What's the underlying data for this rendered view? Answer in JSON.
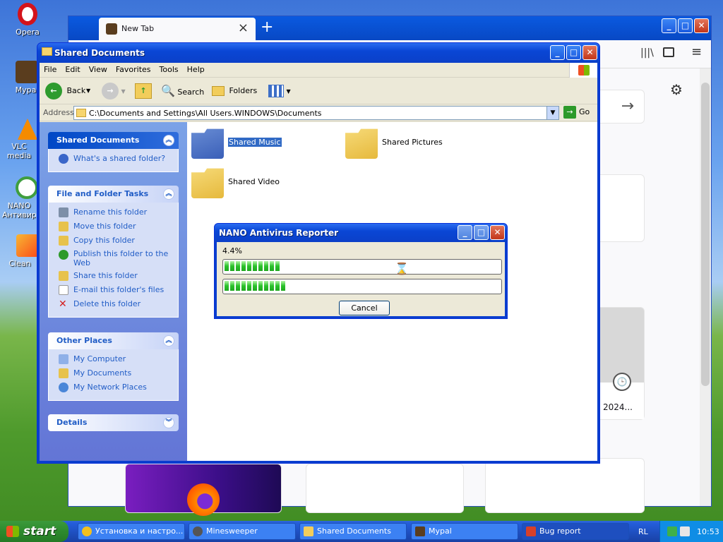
{
  "desktop": {
    "icons": [
      {
        "label": "Opera"
      },
      {
        "label": "Mypal"
      },
      {
        "label": "VLC media player"
      },
      {
        "label": "NANO Антивирус"
      },
      {
        "label": "Clean Master"
      }
    ]
  },
  "firefox": {
    "tab_title": "New Tab",
    "tile_label": "2024..."
  },
  "explorer": {
    "title": "Shared Documents",
    "menu": [
      "File",
      "Edit",
      "View",
      "Favorites",
      "Tools",
      "Help"
    ],
    "toolbar": {
      "back": "Back",
      "search": "Search",
      "folders": "Folders"
    },
    "address_label": "Address",
    "address_value": "C:\\Documents and Settings\\All Users.WINDOWS\\Documents",
    "go_label": "Go",
    "panels": {
      "shared": {
        "title": "Shared Documents",
        "items": [
          "What's a shared folder?"
        ]
      },
      "tasks": {
        "title": "File and Folder Tasks",
        "items": [
          "Rename this folder",
          "Move this folder",
          "Copy this folder",
          "Publish this folder to the Web",
          "Share this folder",
          "E-mail this folder's files",
          "Delete this folder"
        ]
      },
      "other": {
        "title": "Other Places",
        "items": [
          "My Computer",
          "My Documents",
          "My Network Places"
        ]
      },
      "details": {
        "title": "Details"
      }
    },
    "folders": [
      {
        "name": "Shared Music"
      },
      {
        "name": "Shared Pictures"
      },
      {
        "name": "Shared Video"
      }
    ]
  },
  "dialog": {
    "title": "NANO Antivirus Reporter",
    "percent_text": "4.4%",
    "progress1": 0.21,
    "progress2": 0.23,
    "cancel_label": "Cancel"
  },
  "taskbar": {
    "start_label": "start",
    "buttons": [
      {
        "label": "Установка и настро..."
      },
      {
        "label": "Minesweeper"
      },
      {
        "label": "Shared Documents"
      },
      {
        "label": "Mypal"
      },
      {
        "label": "Bug report"
      }
    ],
    "lang": "RL",
    "clock": "10:53"
  }
}
